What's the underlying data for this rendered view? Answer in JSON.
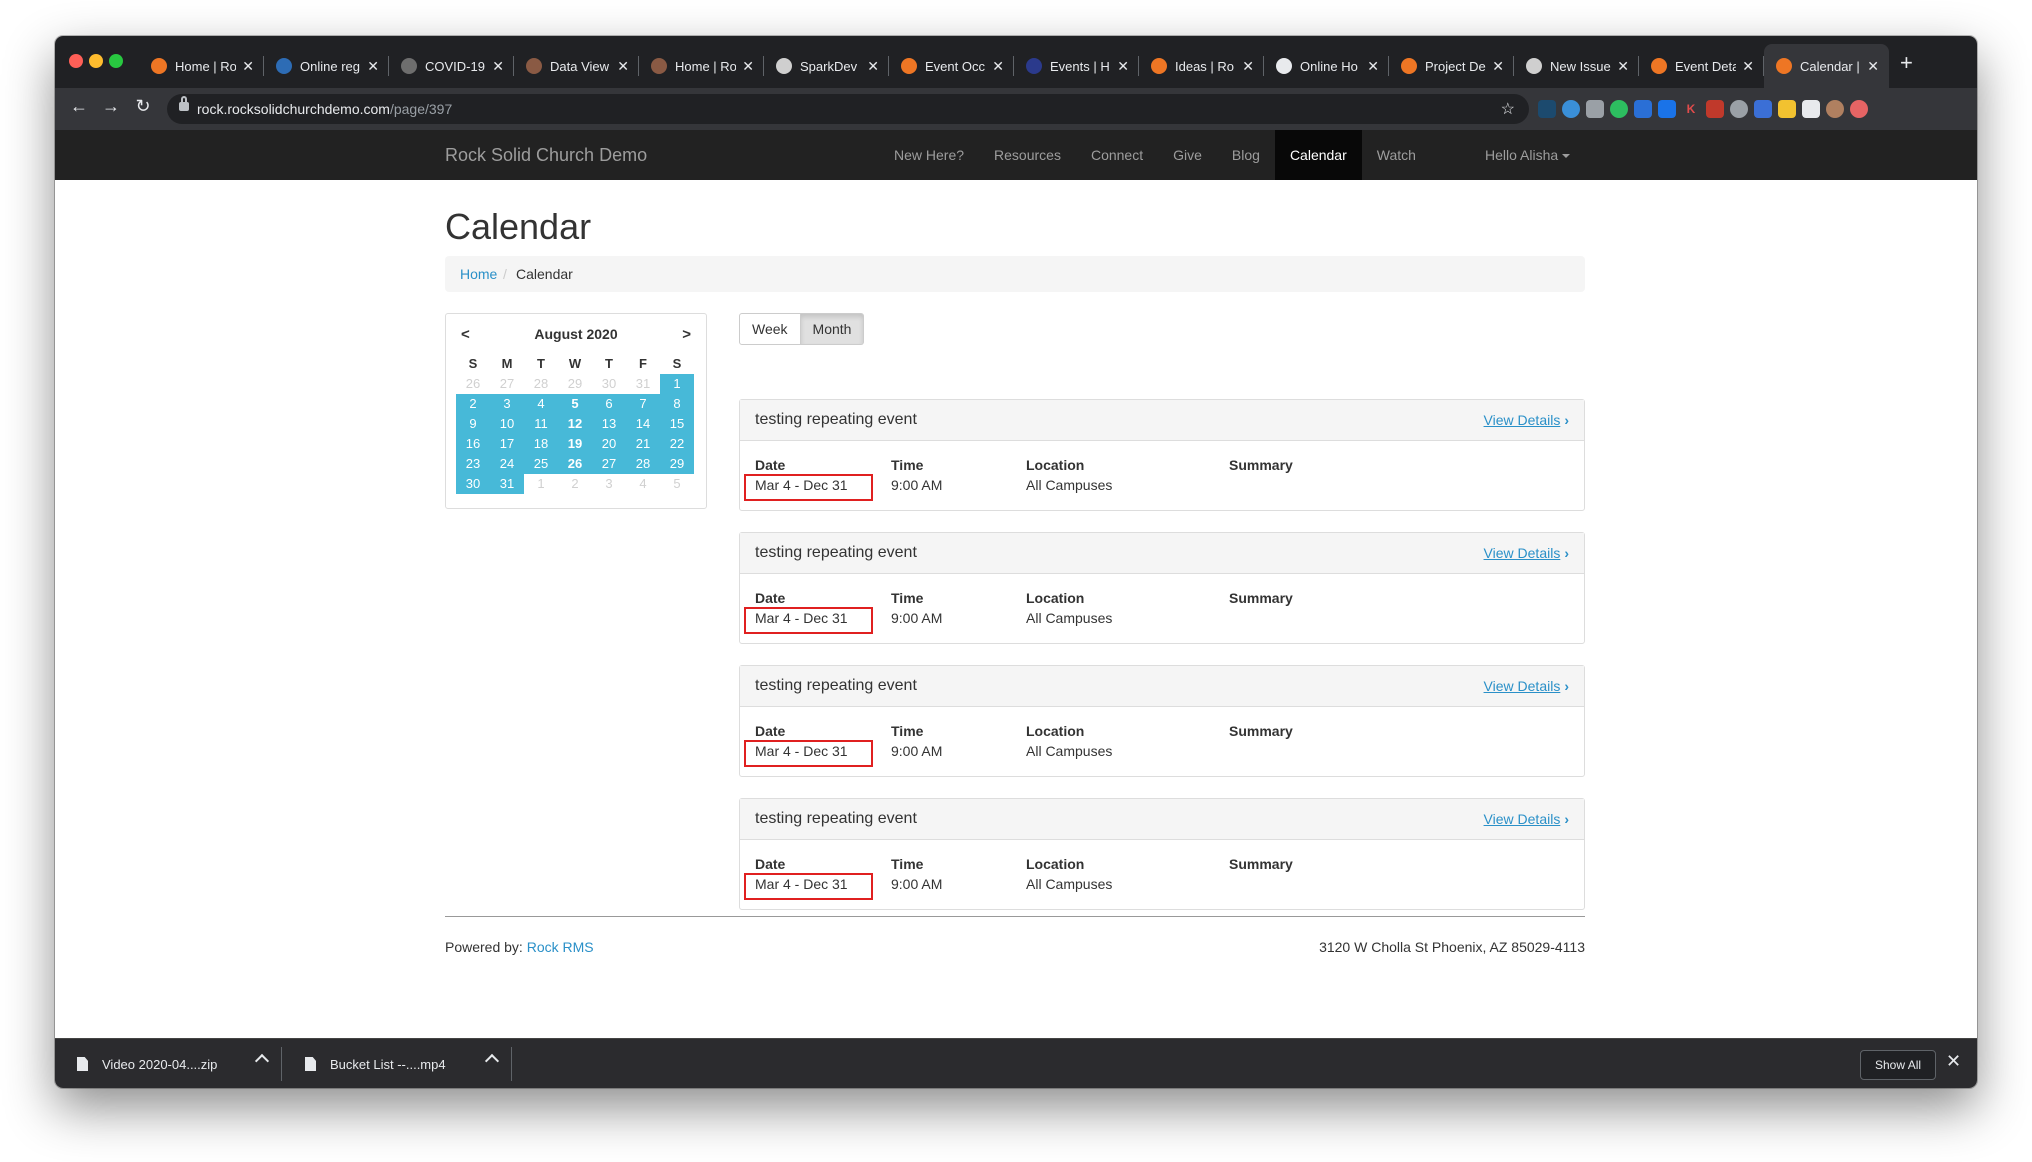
{
  "browser": {
    "tabs": [
      {
        "title": "Home | Ro",
        "icon": "rock-icon",
        "color": "#ee7624"
      },
      {
        "title": "Online reg",
        "icon": "r-icon",
        "color": "#2d6cb5"
      },
      {
        "title": "COVID-19",
        "icon": "globe-icon",
        "color": "#6e6e6e"
      },
      {
        "title": "Data View",
        "icon": "rock-icon",
        "color": "#8a5a44"
      },
      {
        "title": "Home | Ro",
        "icon": "rock-icon",
        "color": "#8a5a44"
      },
      {
        "title": "SparkDev",
        "icon": "github-icon",
        "color": "#cfcfcf"
      },
      {
        "title": "Event Occ",
        "icon": "rock-icon",
        "color": "#ee7624"
      },
      {
        "title": "Events | H",
        "icon": "cross-icon",
        "color": "#2b3a8c"
      },
      {
        "title": "Ideas | Ro",
        "icon": "rock-icon",
        "color": "#ee7624"
      },
      {
        "title": "Online Ho",
        "icon": "circle-icon",
        "color": "#e8eaed"
      },
      {
        "title": "Project De",
        "icon": "rock-icon",
        "color": "#ee7624"
      },
      {
        "title": "New Issue",
        "icon": "github-icon",
        "color": "#cfcfcf"
      },
      {
        "title": "Event Deta",
        "icon": "rock-icon",
        "color": "#ee7624"
      },
      {
        "title": "Calendar |",
        "icon": "rock-icon",
        "color": "#ee7624",
        "active": true
      }
    ],
    "close_glyph": "✕",
    "new_tab_glyph": "+",
    "url_host": "rock.rocksolidchurchdemo.com",
    "url_path": "/page/397",
    "back_glyph": "←",
    "forward_glyph": "→",
    "reload_glyph": "↻",
    "star_glyph": "☆"
  },
  "site": {
    "brand": "Rock Solid Church Demo",
    "nav": [
      "New Here?",
      "Resources",
      "Connect",
      "Give",
      "Blog",
      "Calendar",
      "Watch"
    ],
    "active_nav": "Calendar",
    "user_menu": "Hello Alisha"
  },
  "page": {
    "title": "Calendar",
    "breadcrumb_home": "Home",
    "breadcrumb_sep": "/",
    "breadcrumb_current": "Calendar"
  },
  "mini_calendar": {
    "prev": "<",
    "next": ">",
    "month": "August 2020",
    "days_of_week": [
      "S",
      "M",
      "T",
      "W",
      "T",
      "F",
      "S"
    ],
    "weeks": [
      [
        "26",
        "27",
        "28",
        "29",
        "30",
        "31",
        "1"
      ],
      [
        "2",
        "3",
        "4",
        "5",
        "6",
        "7",
        "8"
      ],
      [
        "9",
        "10",
        "11",
        "12",
        "13",
        "14",
        "15"
      ],
      [
        "16",
        "17",
        "18",
        "19",
        "20",
        "21",
        "22"
      ],
      [
        "23",
        "24",
        "25",
        "26",
        "27",
        "28",
        "29"
      ],
      [
        "30",
        "31",
        "1",
        "2",
        "3",
        "4",
        "5"
      ]
    ],
    "event_days": [
      "5",
      "12",
      "19",
      "26"
    ]
  },
  "view_toggle": {
    "week": "Week",
    "month": "Month",
    "active": "Month"
  },
  "events": [
    {
      "title": "testing repeating event",
      "link": "View Details",
      "date_label": "Date",
      "date": "Mar 4 - Dec 31",
      "time_label": "Time",
      "time": "9:00 AM",
      "location_label": "Location",
      "location": "All Campuses",
      "summary_label": "Summary"
    },
    {
      "title": "testing repeating event",
      "link": "View Details",
      "date_label": "Date",
      "date": "Mar 4 - Dec 31",
      "time_label": "Time",
      "time": "9:00 AM",
      "location_label": "Location",
      "location": "All Campuses",
      "summary_label": "Summary"
    },
    {
      "title": "testing repeating event",
      "link": "View Details",
      "date_label": "Date",
      "date": "Mar 4 - Dec 31",
      "time_label": "Time",
      "time": "9:00 AM",
      "location_label": "Location",
      "location": "All Campuses",
      "summary_label": "Summary"
    },
    {
      "title": "testing repeating event",
      "link": "View Details",
      "date_label": "Date",
      "date": "Mar 4 - Dec 31",
      "time_label": "Time",
      "time": "9:00 AM",
      "location_label": "Location",
      "location": "All Campuses",
      "summary_label": "Summary"
    }
  ],
  "footer": {
    "powered_label": "Powered by:",
    "powered_link": "Rock RMS",
    "address": "3120 W Cholla St Phoenix, AZ 85029-4113"
  },
  "downloads": {
    "items": [
      "Video 2020-04....zip",
      "Bucket List --....mp4"
    ],
    "show_all": "Show All",
    "close_glyph": "✕"
  },
  "colors": {
    "accent": "#2a90c8",
    "calendar_highlight": "#47b9d8",
    "annotation_red": "#e02020"
  }
}
